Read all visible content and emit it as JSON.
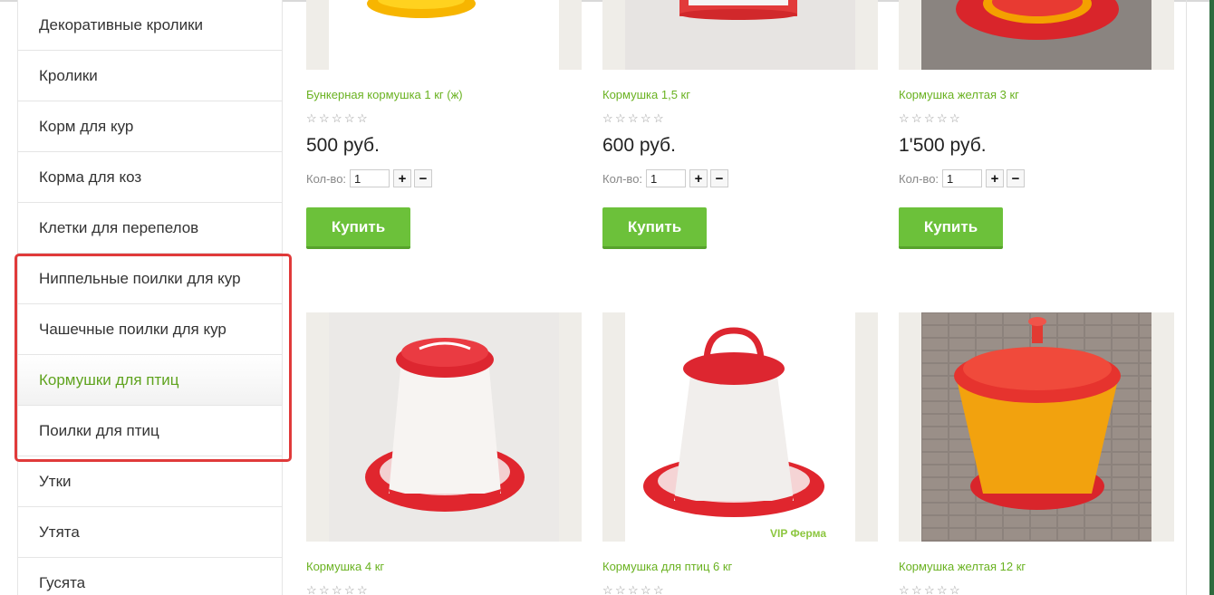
{
  "sidebar": {
    "items": [
      {
        "label": "Декоративные кролики"
      },
      {
        "label": "Кролики"
      },
      {
        "label": "Корм для кур"
      },
      {
        "label": "Корма для коз"
      },
      {
        "label": "Клетки для перепелов"
      },
      {
        "label": "Ниппельные поилки для кур"
      },
      {
        "label": "Чашечные поилки для кур"
      },
      {
        "label": "Кормушки для птиц",
        "active": true
      },
      {
        "label": "Поилки для птиц"
      },
      {
        "label": "Утки"
      },
      {
        "label": "Утята"
      },
      {
        "label": "Гусята"
      }
    ]
  },
  "products": [
    {
      "name": "Бункерная кормушка 1 кг (ж)",
      "price": "500 руб.",
      "qty_label": "Кол-во:",
      "qty": "1",
      "buy": "Купить"
    },
    {
      "name": "Кормушка 1,5 кг",
      "price": "600 руб.",
      "qty_label": "Кол-во:",
      "qty": "1",
      "buy": "Купить"
    },
    {
      "name": "Кормушка желтая 3 кг",
      "price": "1'500 руб.",
      "qty_label": "Кол-во:",
      "qty": "1",
      "buy": "Купить"
    },
    {
      "name": "Кормушка 4 кг"
    },
    {
      "name": "Кормушка для птиц 6 кг",
      "watermark": "VIP Ферма"
    },
    {
      "name": "Кормушка желтая 12 кг"
    }
  ],
  "colors": {
    "accent": "#6ab221",
    "button": "#6cc13a",
    "highlight": "#e03a3a"
  }
}
